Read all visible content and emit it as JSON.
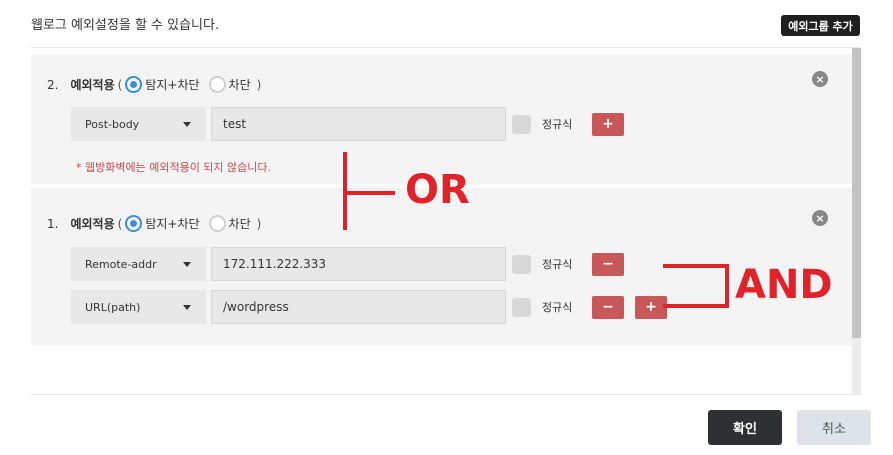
{
  "header": {
    "title": "웹로그 예외설정을 할 수 있습니다.",
    "add_group_label": "예외그룹 추가"
  },
  "groups": [
    {
      "number": "2.",
      "label": "예외적용",
      "paren_open": "(",
      "paren_close": ")",
      "option_detect_block": "탐지+차단",
      "option_block": "차단",
      "selected_option": "탐지+차단",
      "close_icon": "×",
      "conditions": [
        {
          "field": "Post-body",
          "value": "test",
          "regex_label": "정규식",
          "regex_checked": false,
          "buttons": [
            "+"
          ]
        }
      ],
      "note": "* 웹방화벽에는 예외적용이 되지 않습니다."
    },
    {
      "number": "1.",
      "label": "예외적용",
      "paren_open": "(",
      "paren_close": ")",
      "option_detect_block": "탐지+차단",
      "option_block": "차단",
      "selected_option": "탐지+차단",
      "close_icon": "×",
      "conditions": [
        {
          "field": "Remote-addr",
          "value": "172.111.222.333",
          "regex_label": "정규식",
          "regex_checked": false,
          "buttons": [
            "−"
          ]
        },
        {
          "field": "URL(path)",
          "value": "/wordpress",
          "regex_label": "정규식",
          "regex_checked": false,
          "buttons": [
            "−",
            "+"
          ]
        }
      ]
    }
  ],
  "annotations": {
    "or_label": "OR",
    "and_label": "AND",
    "color": "#e0232a"
  },
  "footer": {
    "confirm_label": "확인",
    "cancel_label": "취소"
  },
  "colors": {
    "accent_radio": "#3b8fd9",
    "danger_button": "#c8575a",
    "primary_button": "#2e3033"
  }
}
